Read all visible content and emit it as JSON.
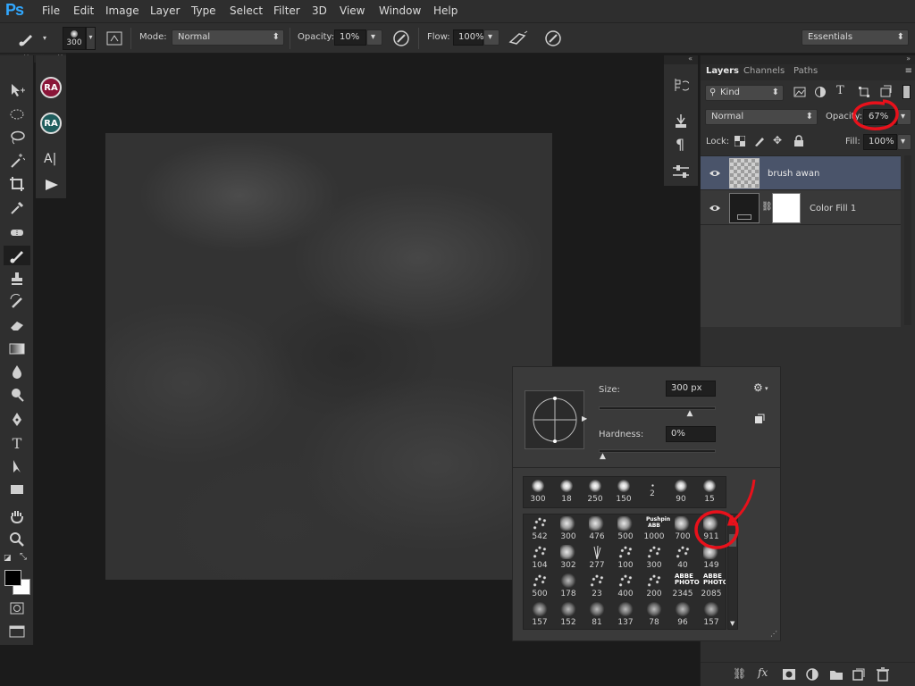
{
  "app": {
    "logo": "Ps"
  },
  "menu": [
    "File",
    "Edit",
    "Image",
    "Layer",
    "Type",
    "Select",
    "Filter",
    "3D",
    "View",
    "Window",
    "Help"
  ],
  "options": {
    "brush_size": "300",
    "mode_label": "Mode:",
    "mode_value": "Normal",
    "opacity_label": "Opacity:",
    "opacity_value": "10%",
    "flow_label": "Flow:",
    "flow_value": "100%",
    "workspace": "Essentials"
  },
  "subpanel": {
    "badge1": "RA",
    "badge2": "RA",
    "badge1_color": "#8a1538",
    "badge2_color": "#1f5e5e"
  },
  "layers_panel": {
    "tabs": [
      "Layers",
      "Channels",
      "Paths"
    ],
    "kind_label": "Kind",
    "blend_mode": "Normal",
    "opacity_label": "Opacity:",
    "opacity_value": "67%",
    "lock_label": "Lock:",
    "fill_label": "Fill:",
    "fill_value": "100%",
    "layers": [
      {
        "name": "brush awan",
        "selected": true
      },
      {
        "name": "Color Fill 1",
        "selected": false
      }
    ]
  },
  "brush_picker": {
    "size_label": "Size:",
    "size_value": "300 px",
    "hardness_label": "Hardness:",
    "hardness_value": "0%",
    "size_fraction": 0.78,
    "hardness_fraction": 0.0,
    "recent": [
      "300",
      "18",
      "250",
      "150",
      "2",
      "90",
      "15"
    ],
    "presets": [
      [
        "542",
        "300",
        "476",
        "500",
        "1000",
        "700",
        "911"
      ],
      [
        "104",
        "302",
        "277",
        "100",
        "300",
        "40",
        "149"
      ],
      [
        "500",
        "178",
        "23",
        "400",
        "200",
        "2345",
        "2085"
      ],
      [
        "157",
        "152",
        "81",
        "137",
        "78",
        "96",
        "157"
      ]
    ],
    "preset_labels": {
      "pushpin": "Pushpin ABB",
      "abbe_photo": "ABBE PHOTO"
    }
  },
  "annotation_color": "#e8111b",
  "accent_color": "#31a8ff"
}
